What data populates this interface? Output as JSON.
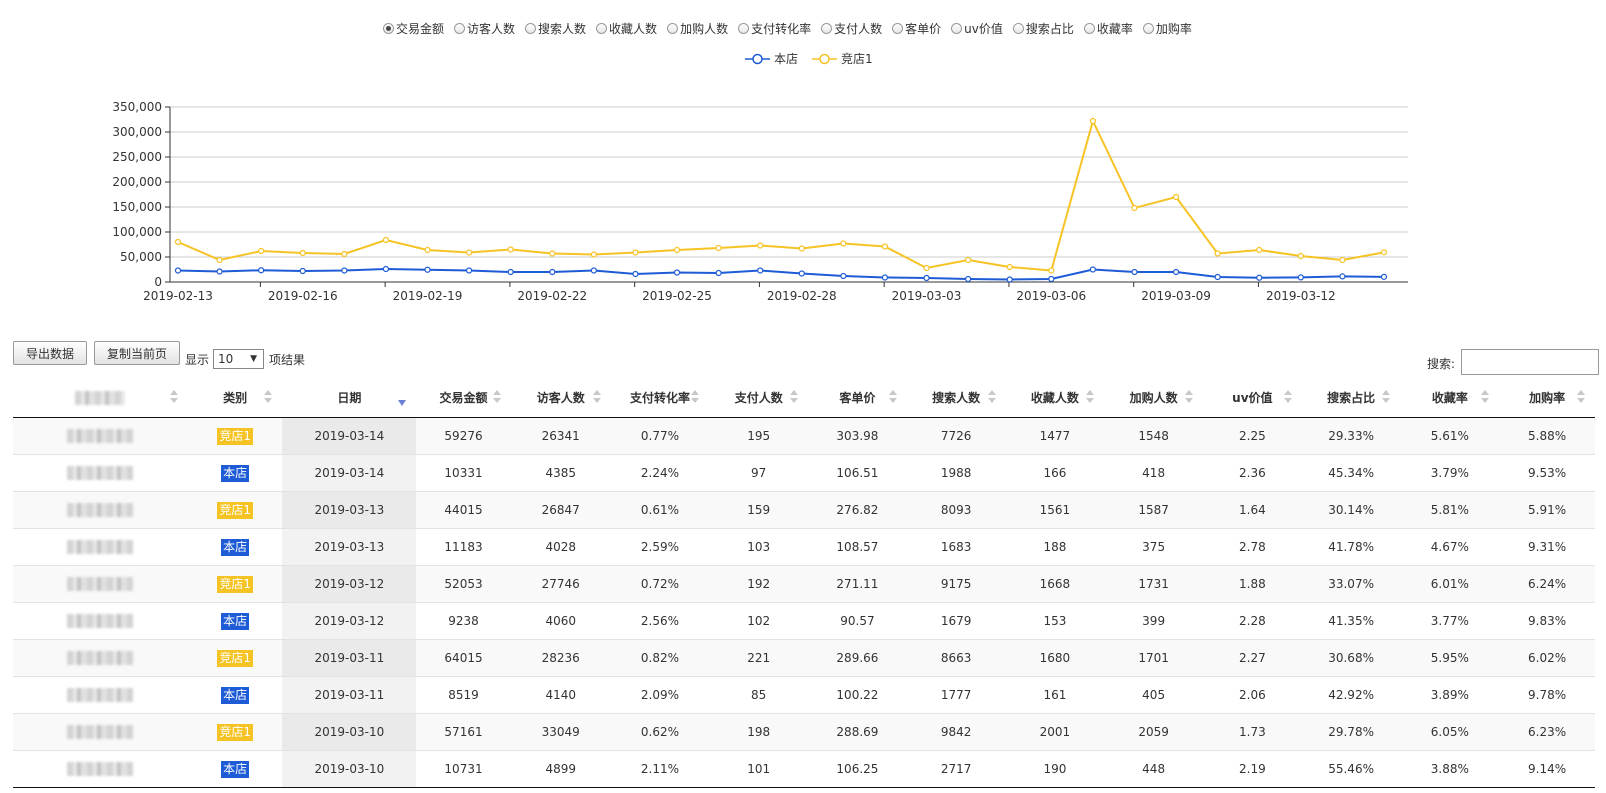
{
  "metrics": [
    {
      "label": "交易金额",
      "checked": true
    },
    {
      "label": "访客人数",
      "checked": false
    },
    {
      "label": "搜索人数",
      "checked": false
    },
    {
      "label": "收藏人数",
      "checked": false
    },
    {
      "label": "加购人数",
      "checked": false
    },
    {
      "label": "支付转化率",
      "checked": false
    },
    {
      "label": "支付人数",
      "checked": false
    },
    {
      "label": "客单价",
      "checked": false
    },
    {
      "label": "uv价值",
      "checked": false
    },
    {
      "label": "搜索占比",
      "checked": false
    },
    {
      "label": "收藏率",
      "checked": false
    },
    {
      "label": "加购率",
      "checked": false
    }
  ],
  "colors": {
    "self": "#1e5bd6",
    "competitor": "#f6c325",
    "grid": "#cccccc",
    "axis": "#333333",
    "sort_active": "#6b7fd6"
  },
  "chart_data": {
    "type": "line",
    "title": "",
    "xlabel": "",
    "ylabel": "",
    "ylim": [
      0,
      350000
    ],
    "y_ticks": [
      "0",
      "50,000",
      "100,000",
      "150,000",
      "200,000",
      "250,000",
      "300,000",
      "350,000"
    ],
    "y_tick_values": [
      0,
      50000,
      100000,
      150000,
      200000,
      250000,
      300000,
      350000
    ],
    "x": [
      "2019-02-13",
      "2019-02-14",
      "2019-02-15",
      "2019-02-16",
      "2019-02-17",
      "2019-02-18",
      "2019-02-19",
      "2019-02-20",
      "2019-02-21",
      "2019-02-22",
      "2019-02-23",
      "2019-02-24",
      "2019-02-25",
      "2019-02-26",
      "2019-02-27",
      "2019-02-28",
      "2019-03-01",
      "2019-03-02",
      "2019-03-03",
      "2019-03-04",
      "2019-03-05",
      "2019-03-06",
      "2019-03-07",
      "2019-03-08",
      "2019-03-09",
      "2019-03-10",
      "2019-03-11",
      "2019-03-12",
      "2019-03-13",
      "2019-03-14"
    ],
    "x_tick_labels": [
      "2019-02-13",
      "2019-02-16",
      "2019-02-19",
      "2019-02-22",
      "2019-02-25",
      "2019-02-28",
      "2019-03-03",
      "2019-03-06",
      "2019-03-09",
      "2019-03-12"
    ],
    "grid": true,
    "legend": "top-center",
    "series": [
      {
        "name": "本店",
        "color": "#1e5bd6",
        "values": [
          23000,
          21000,
          23500,
          22000,
          23000,
          26000,
          24500,
          23000,
          20000,
          20000,
          23000,
          16000,
          19000,
          18000,
          23000,
          17000,
          12000,
          9000,
          8000,
          6000,
          5000,
          6000,
          25000,
          20000,
          20000,
          10000,
          8500,
          9200,
          11200,
          10300
        ]
      },
      {
        "name": "竞店1",
        "color": "#f6c325",
        "values": [
          80000,
          44000,
          62000,
          58000,
          56000,
          84000,
          64000,
          59000,
          65000,
          57000,
          55000,
          59000,
          64000,
          68000,
          73000,
          67000,
          77000,
          71000,
          28000,
          44000,
          30000,
          23000,
          322000,
          148000,
          170000,
          57000,
          64000,
          52000,
          44000,
          59300
        ]
      }
    ]
  },
  "toolbar": {
    "export_label": "导出数据",
    "copy_label": "复制当前页",
    "show_label": "显示",
    "page_size": "10",
    "result_label": "项结果",
    "search_label": "搜索:"
  },
  "table": {
    "columns": [
      "店铺名",
      "类别",
      "日期",
      "交易金额",
      "访客人数",
      "支付转化率",
      "支付人数",
      "客单价",
      "搜索人数",
      "收藏人数",
      "加购人数",
      "uv价值",
      "搜索占比",
      "收藏率",
      "加购率"
    ],
    "rows": [
      {
        "type": "comp",
        "category": "竞店1",
        "date": "2019-03-14",
        "cells": [
          "59276",
          "26341",
          "0.77%",
          "195",
          "303.98",
          "7726",
          "1477",
          "1548",
          "2.25",
          "29.33%",
          "5.61%",
          "5.88%"
        ]
      },
      {
        "type": "self",
        "category": "本店",
        "date": "2019-03-14",
        "cells": [
          "10331",
          "4385",
          "2.24%",
          "97",
          "106.51",
          "1988",
          "166",
          "418",
          "2.36",
          "45.34%",
          "3.79%",
          "9.53%"
        ]
      },
      {
        "type": "comp",
        "category": "竞店1",
        "date": "2019-03-13",
        "cells": [
          "44015",
          "26847",
          "0.61%",
          "159",
          "276.82",
          "8093",
          "1561",
          "1587",
          "1.64",
          "30.14%",
          "5.81%",
          "5.91%"
        ]
      },
      {
        "type": "self",
        "category": "本店",
        "date": "2019-03-13",
        "cells": [
          "11183",
          "4028",
          "2.59%",
          "103",
          "108.57",
          "1683",
          "188",
          "375",
          "2.78",
          "41.78%",
          "4.67%",
          "9.31%"
        ]
      },
      {
        "type": "comp",
        "category": "竞店1",
        "date": "2019-03-12",
        "cells": [
          "52053",
          "27746",
          "0.72%",
          "192",
          "271.11",
          "9175",
          "1668",
          "1731",
          "1.88",
          "33.07%",
          "6.01%",
          "6.24%"
        ]
      },
      {
        "type": "self",
        "category": "本店",
        "date": "2019-03-12",
        "cells": [
          "9238",
          "4060",
          "2.56%",
          "102",
          "90.57",
          "1679",
          "153",
          "399",
          "2.28",
          "41.35%",
          "3.77%",
          "9.83%"
        ]
      },
      {
        "type": "comp",
        "category": "竞店1",
        "date": "2019-03-11",
        "cells": [
          "64015",
          "28236",
          "0.82%",
          "221",
          "289.66",
          "8663",
          "1680",
          "1701",
          "2.27",
          "30.68%",
          "5.95%",
          "6.02%"
        ]
      },
      {
        "type": "self",
        "category": "本店",
        "date": "2019-03-11",
        "cells": [
          "8519",
          "4140",
          "2.09%",
          "85",
          "100.22",
          "1777",
          "161",
          "405",
          "2.06",
          "42.92%",
          "3.89%",
          "9.78%"
        ]
      },
      {
        "type": "comp",
        "category": "竞店1",
        "date": "2019-03-10",
        "cells": [
          "57161",
          "33049",
          "0.62%",
          "198",
          "288.69",
          "9842",
          "2001",
          "2059",
          "1.73",
          "29.78%",
          "6.05%",
          "6.23%"
        ]
      },
      {
        "type": "self",
        "category": "本店",
        "date": "2019-03-10",
        "cells": [
          "10731",
          "4899",
          "2.11%",
          "101",
          "106.25",
          "2717",
          "190",
          "448",
          "2.19",
          "55.46%",
          "3.88%",
          "9.14%"
        ]
      }
    ]
  }
}
